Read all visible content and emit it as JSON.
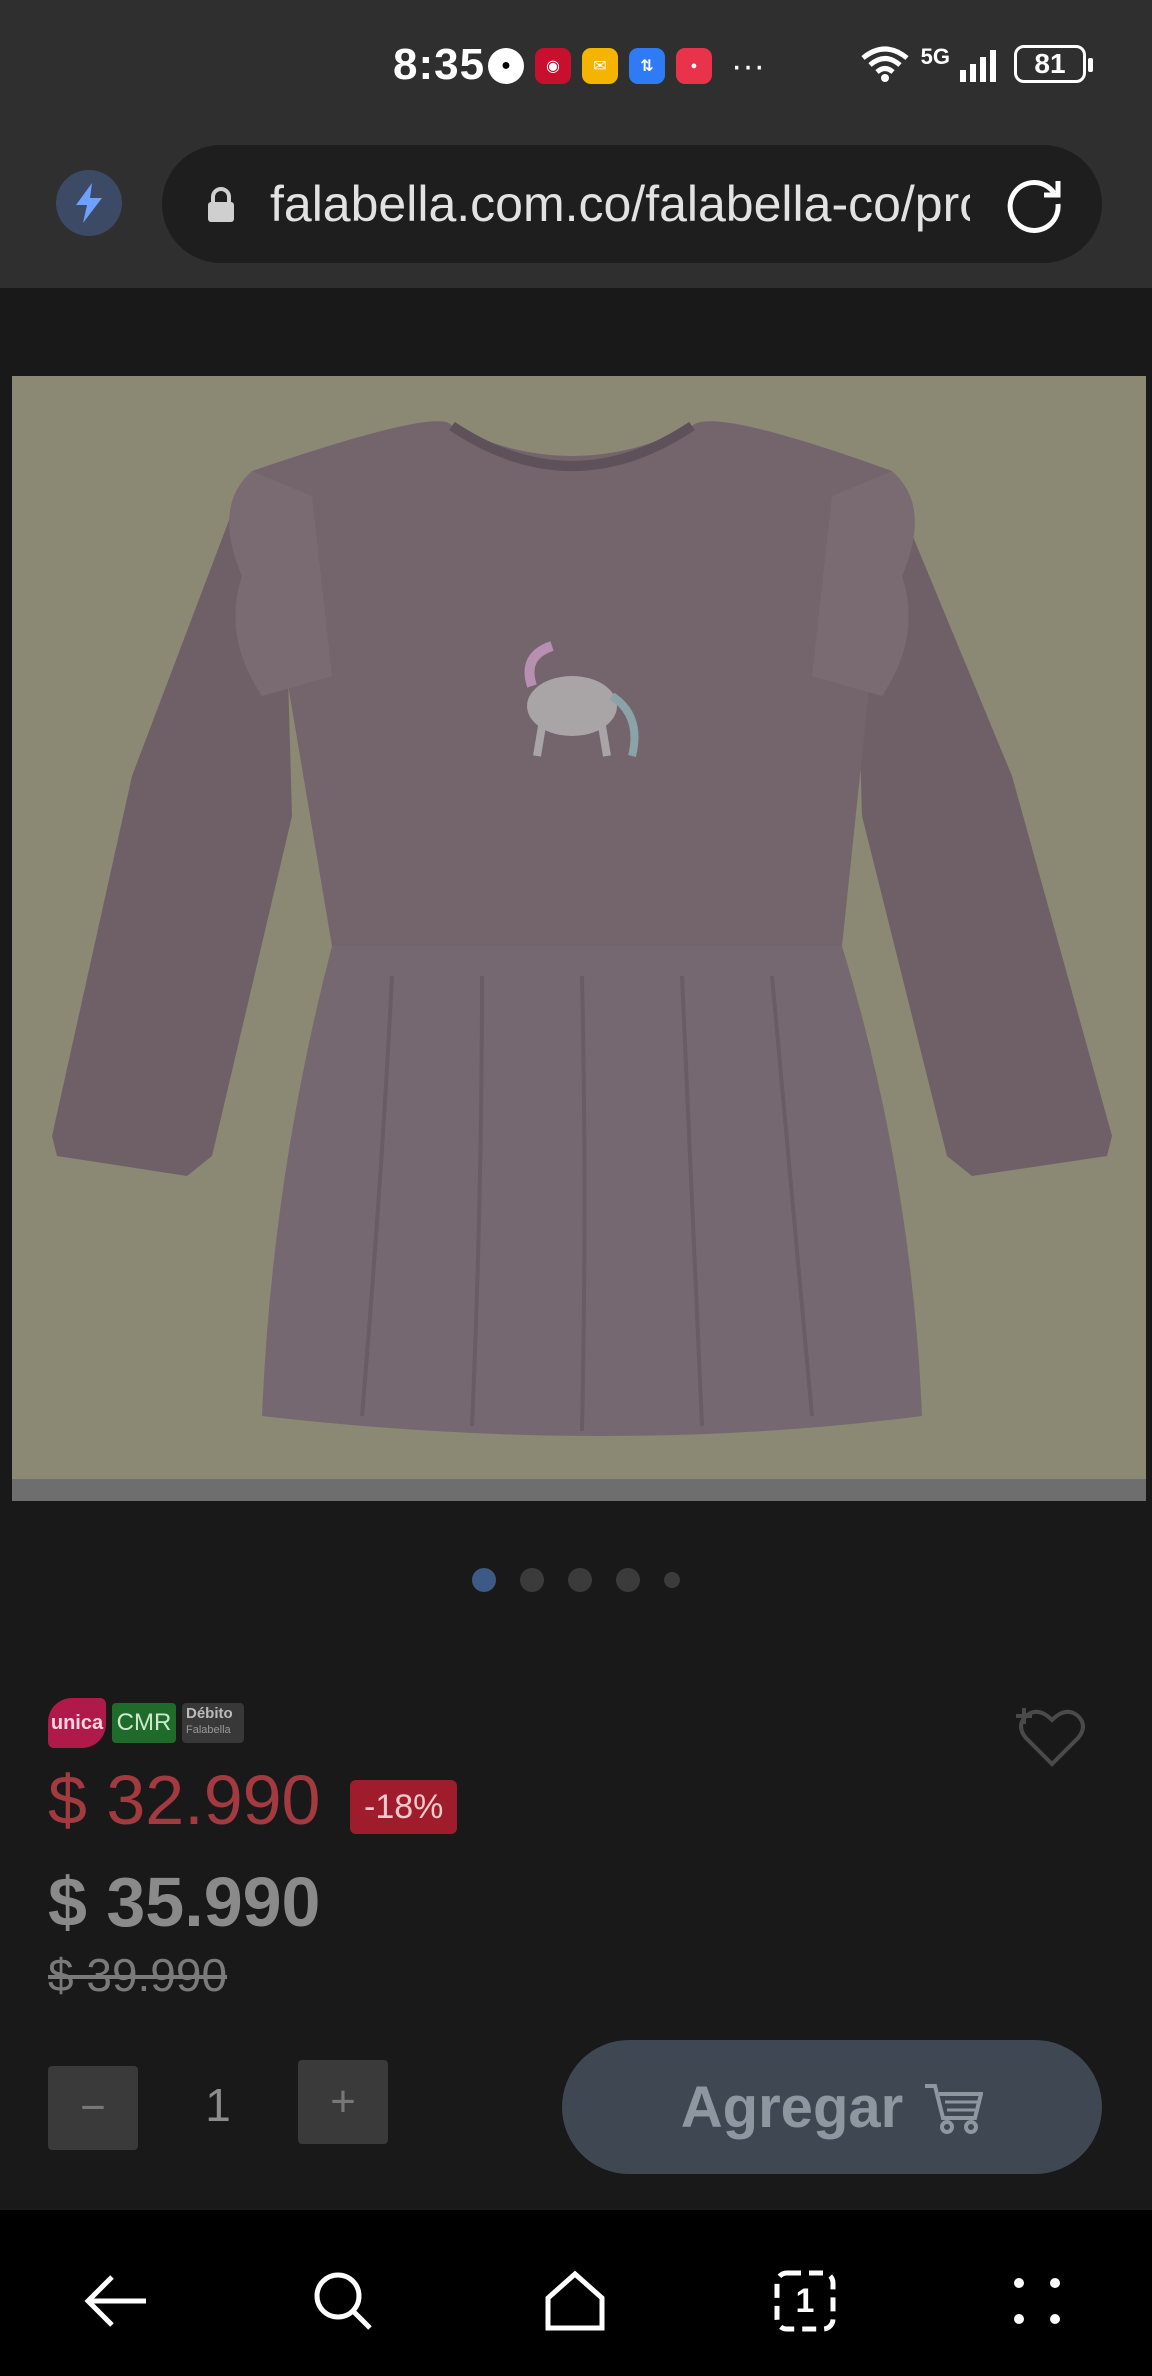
{
  "status_bar": {
    "time": "8:35",
    "notifications": [
      "app-icon",
      "app-icon",
      "mail-icon",
      "app-icon",
      "app-icon"
    ],
    "more": "···",
    "network": "5G",
    "battery": "81"
  },
  "browser": {
    "url": "falabella.com.co/falabella-co/pro",
    "tabs_count": "1"
  },
  "product": {
    "image_pages": 5,
    "active_image": 0,
    "payment_badges": {
      "unica": "unica",
      "cmr": "CMR",
      "debito": "Débito",
      "debito_sub": "Falabella"
    },
    "price_card": "$ 32.990",
    "discount": "-18%",
    "price_internet": "$ 35.990",
    "price_normal": "$ 39.990",
    "quantity": "1",
    "qty_minus": "−",
    "qty_plus": "+",
    "add_button": "Agregar"
  },
  "colors": {
    "accent_blue": "#3d5a84",
    "price_red": "#a33a40",
    "discount_bg": "#9f1c2c",
    "cmr_green": "#1f6c2a"
  }
}
